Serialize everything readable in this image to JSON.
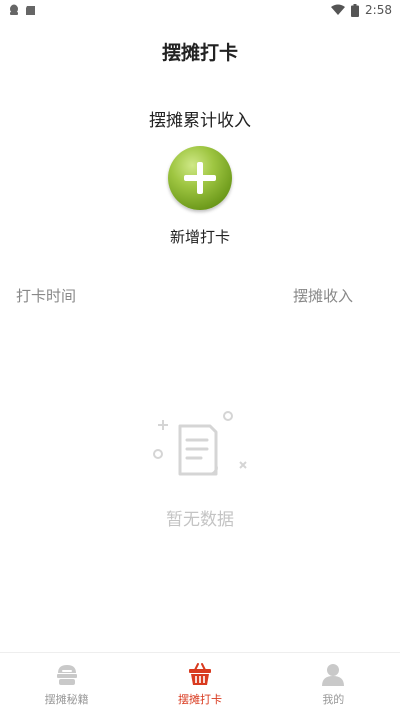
{
  "status_bar": {
    "time": "2:58",
    "left_icons": [
      "qq-notification-icon",
      "sd-card-icon"
    ],
    "right_icons": [
      "wifi-icon",
      "battery-icon"
    ]
  },
  "header": {
    "title": "摆摊打卡"
  },
  "summary": {
    "income_label": "摆摊累计收入"
  },
  "add_action": {
    "label": "新增打卡",
    "icon": "plus-icon",
    "color": "#8bb73a"
  },
  "table": {
    "columns": [
      "打卡时间",
      "摆摊收入"
    ]
  },
  "empty_state": {
    "text": "暂无数据",
    "icon": "empty-document-icon"
  },
  "bottom_nav": {
    "active_color": "#d93a1f",
    "items": [
      {
        "label": "摆摊秘籍",
        "icon": "stall-tips-icon",
        "active": false
      },
      {
        "label": "摆摊打卡",
        "icon": "basket-icon",
        "active": true
      },
      {
        "label": "我的",
        "icon": "profile-icon",
        "active": false
      }
    ]
  }
}
